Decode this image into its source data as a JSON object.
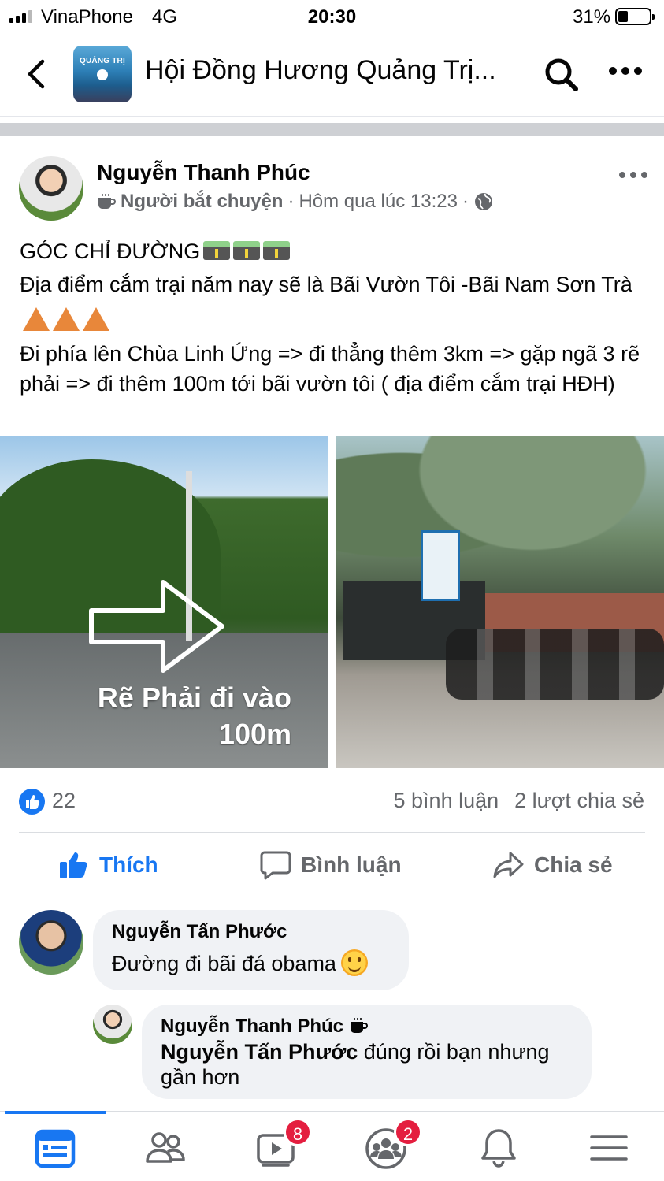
{
  "status_bar": {
    "carrier": "VinaPhone",
    "network": "4G",
    "time": "20:30",
    "battery": "31%"
  },
  "header": {
    "title": "Hội Đồng Hương Quảng Trị...",
    "group_avatar_text": "QUẢNG TRỊ",
    "icons": [
      "back-icon",
      "search-icon",
      "more-icon"
    ]
  },
  "post": {
    "author": "Nguyễn Thanh Phúc",
    "badge": "Người bắt chuyện",
    "timestamp": "Hôm qua lúc 13:23",
    "separator": "·",
    "privacy_icon": "globe-icon",
    "text_line1": "GÓC CHỈ ĐƯỜNG",
    "text_line2": "Địa điểm cắm trại năm nay sẽ là Bãi Vườn Tôi -Bãi Nam Sơn Trà",
    "text_line3": "Đi phía lên Chùa Linh Ứng => đi thẳng thêm 3km => gặp ngã 3 rẽ phải => đi thêm 100m tới bãi vườn tôi ( địa điểm cắm trại HĐH)",
    "photo_left_caption": "Rẽ Phải đi vào 100m",
    "like_count": "22",
    "comment_count": "5 bình luận",
    "share_count": "2 lượt chia sẻ"
  },
  "actions": {
    "like": "Thích",
    "comment": "Bình luận",
    "share": "Chia sẻ"
  },
  "comments": [
    {
      "name": "Nguyễn Tấn Phước",
      "text": "Đường đi bãi đá obama"
    },
    {
      "name": "Nguyễn Thanh Phúc",
      "mention": "Nguyễn Tấn Phước",
      "text": " đúng rồi bạn nhưng gần hơn"
    }
  ],
  "tab_bar": {
    "tabs": [
      "news-feed-icon",
      "friends-icon",
      "watch-icon",
      "groups-icon",
      "notifications-icon",
      "menu-icon"
    ],
    "watch_badge": "8",
    "groups_badge": "2"
  },
  "colors": {
    "accent": "#1877f2",
    "muted": "#65676b",
    "badge": "#e41e3f",
    "bubble": "#f0f2f5"
  }
}
